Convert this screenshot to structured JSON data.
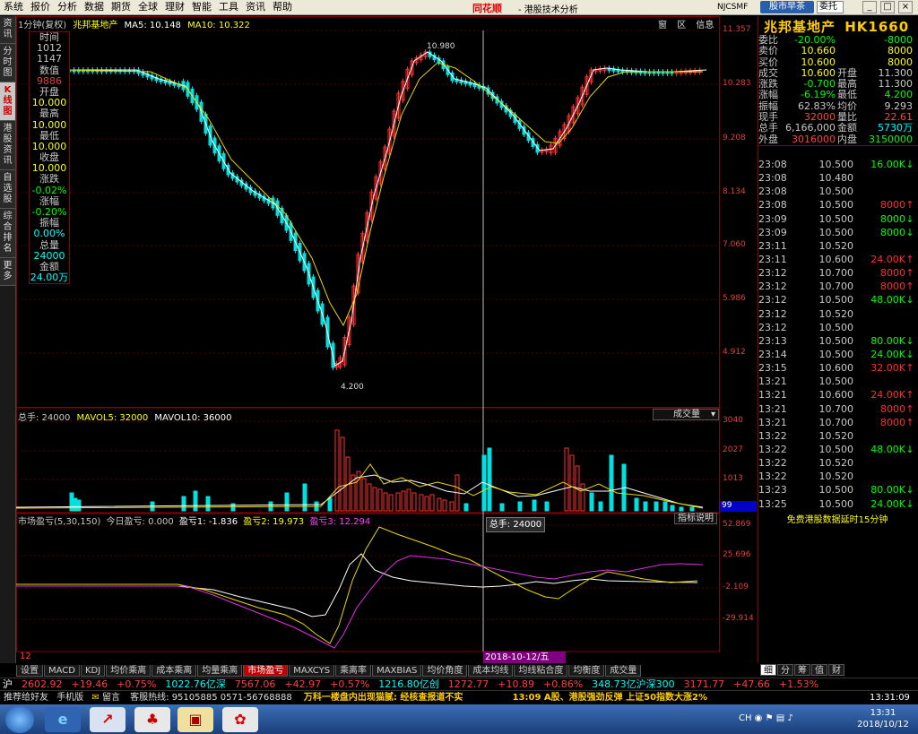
{
  "menu": [
    "系统",
    "报价",
    "分析",
    "数据",
    "期货",
    "全球",
    "理财",
    "智能",
    "工具",
    "资讯",
    "帮助"
  ],
  "brand": "同花顺",
  "brand_sub": "- 港股技术分析",
  "nj": "NJCSMF",
  "morning_btn": "股市早茶",
  "dele_btn": "委托",
  "win_btns": [
    "_",
    "□",
    "×"
  ],
  "left_tabs": [
    "资讯",
    "分时图",
    "K线图",
    "港股资讯",
    "自选股",
    "综合排名",
    "更多"
  ],
  "chart_header": {
    "period": "1分钟(复权)",
    "name": "兆邦基地产",
    "ma5": "MA5: 10.148",
    "ma10": "MA10: 10.322",
    "buttons": [
      "窗",
      "区",
      "信息"
    ]
  },
  "price_axis": [
    "11.357",
    "10.283",
    "9.208",
    "8.134",
    "7.060",
    "5.986",
    "4.912"
  ],
  "hi_label": "10.980",
  "lo_label": "4.200",
  "info_box": [
    {
      "t": "时间",
      "c": "#c8c8c8"
    },
    {
      "t": "1012",
      "c": "#c8c8c8"
    },
    {
      "t": "1147",
      "c": "#c8c8c8"
    },
    {
      "t": "数值",
      "c": "#c8c8c8"
    },
    {
      "t": "9886",
      "c": "#e04040"
    },
    {
      "t": "开盘",
      "c": "#c8c8c8"
    },
    {
      "t": "10.000",
      "c": "#ffff00"
    },
    {
      "t": "最高",
      "c": "#c8c8c8"
    },
    {
      "t": "10.000",
      "c": "#ffff00"
    },
    {
      "t": "最低",
      "c": "#c8c8c8"
    },
    {
      "t": "10.000",
      "c": "#ffff00"
    },
    {
      "t": "收盘",
      "c": "#c8c8c8"
    },
    {
      "t": "10.000",
      "c": "#ffff00"
    },
    {
      "t": "涨跌",
      "c": "#c8c8c8"
    },
    {
      "t": "-0.02%",
      "c": "#00ff00"
    },
    {
      "t": "涨幅",
      "c": "#c8c8c8"
    },
    {
      "t": "-0.20%",
      "c": "#00ff00"
    },
    {
      "t": "振幅",
      "c": "#c8c8c8"
    },
    {
      "t": "0.00%",
      "c": "#00ffff"
    },
    {
      "t": "总量",
      "c": "#c8c8c8"
    },
    {
      "t": "24000",
      "c": "#00ffff"
    },
    {
      "t": "金额",
      "c": "#c8c8c8"
    },
    {
      "t": "24.00万",
      "c": "#00ffff"
    }
  ],
  "vol_header": {
    "total": "总手: 24000",
    "mavol5": "MAVOL5: 32000",
    "mavol10": "MAVOL10: 36000",
    "dropdown": "成交量"
  },
  "vol_axis": [
    "3040",
    "2027",
    "1013"
  ],
  "vol_marker": "99",
  "ind_header": {
    "name": "市场盈亏(5,30,150)",
    "today": "今日盈亏: 0.000",
    "y1": "盈亏1: -1.836",
    "y2": "盈亏2: 19.973",
    "y3": "盈亏3: 12.294",
    "help": "指标说明"
  },
  "ind_axis": [
    "52.869",
    "25.696",
    "-2.109",
    "-29.914"
  ],
  "tooltip": "总手: 24000",
  "date_label": "2018-10-12/五",
  "left_num": "12",
  "bottom_tabs": [
    "设置",
    "MACD",
    "KDJ",
    "均价乘离",
    "成本乘离",
    "均量乘离",
    "市场盈亏",
    "MAXCYS",
    "乘离率",
    "MAXBIAS",
    "均价角度",
    "成本均线",
    "均线粘合度",
    "均衡度",
    "成交量"
  ],
  "active_bottom_tab": "市场盈亏",
  "stock": {
    "name": "兆邦基地产",
    "code": "HK1660"
  },
  "quote": [
    {
      "l": "委比",
      "v": "-20.00%",
      "vc": "#00ff00",
      "r": "",
      "rv": "-8000",
      "rc": "#00ff00"
    },
    {
      "l": "卖价",
      "v": "10.660",
      "vc": "#ffff00",
      "r": "",
      "rv": "8000",
      "rc": "#ffff00"
    },
    {
      "l": "买价",
      "v": "10.600",
      "vc": "#ffff00",
      "r": "",
      "rv": "8000",
      "rc": "#ffff00"
    },
    {
      "l": "成交",
      "v": "10.600",
      "vc": "#ffff00",
      "r": "开盘",
      "rv": "11.300",
      "rc": "#c8c8c8"
    },
    {
      "l": "涨跌",
      "v": "-0.700",
      "vc": "#00ff00",
      "r": "最高",
      "rv": "11.300",
      "rc": "#c8c8c8"
    },
    {
      "l": "涨幅",
      "v": "-6.19%",
      "vc": "#00ff00",
      "r": "最低",
      "rv": "4.200",
      "rc": "#00ff00"
    },
    {
      "l": "振幅",
      "v": "62.83%",
      "vc": "#c8c8c8",
      "r": "均价",
      "rv": "9.293",
      "rc": "#c8c8c8"
    },
    {
      "l": "现手",
      "v": "32000",
      "vc": "#ff4040",
      "r": "量比",
      "rv": "22.61",
      "rc": "#ff4040"
    },
    {
      "l": "总手",
      "v": "6,166,000",
      "vc": "#c8c8c8",
      "r": "金额",
      "rv": "5730万",
      "rc": "#00ffff"
    },
    {
      "l": "外盘",
      "v": "3016000",
      "vc": "#ff4040",
      "r": "内盘",
      "rv": "3150000",
      "rc": "#00ff00"
    }
  ],
  "trades": [
    {
      "t": "23:08",
      "p": "10.500",
      "v": "16.00K",
      "c": "#00ff00",
      "a": "↓"
    },
    {
      "t": "23:08",
      "p": "10.480",
      "v": "",
      "c": "#c8c8c8",
      "a": ""
    },
    {
      "t": "23:08",
      "p": "10.500",
      "v": "",
      "c": "#c8c8c8",
      "a": ""
    },
    {
      "t": "23:08",
      "p": "10.500",
      "v": "8000",
      "c": "#ff3030",
      "a": "↑"
    },
    {
      "t": "23:09",
      "p": "10.500",
      "v": "8000",
      "c": "#00ff00",
      "a": "↓"
    },
    {
      "t": "23:09",
      "p": "10.500",
      "v": "8000",
      "c": "#00ff00",
      "a": "↓"
    },
    {
      "t": "23:11",
      "p": "10.520",
      "v": "",
      "c": "#c8c8c8",
      "a": ""
    },
    {
      "t": "23:11",
      "p": "10.600",
      "v": "24.00K",
      "c": "#ff3030",
      "a": "↑"
    },
    {
      "t": "23:12",
      "p": "10.700",
      "v": "8000",
      "c": "#ff3030",
      "a": "↑"
    },
    {
      "t": "23:12",
      "p": "10.700",
      "v": "8000",
      "c": "#ff3030",
      "a": "↑"
    },
    {
      "t": "23:12",
      "p": "10.500",
      "v": "48.00K",
      "c": "#00ff00",
      "a": "↓"
    },
    {
      "t": "23:12",
      "p": "10.520",
      "v": "",
      "c": "#c8c8c8",
      "a": ""
    },
    {
      "t": "23:12",
      "p": "10.500",
      "v": "",
      "c": "#c8c8c8",
      "a": ""
    },
    {
      "t": "23:13",
      "p": "10.500",
      "v": "80.00K",
      "c": "#00ff00",
      "a": "↓"
    },
    {
      "t": "23:14",
      "p": "10.500",
      "v": "24.00K",
      "c": "#00ff00",
      "a": "↓"
    },
    {
      "t": "23:15",
      "p": "10.600",
      "v": "32.00K",
      "c": "#ff3030",
      "a": "↑"
    },
    {
      "t": "13:21",
      "p": "10.500",
      "v": "",
      "c": "#c8c8c8",
      "a": ""
    },
    {
      "t": "13:21",
      "p": "10.600",
      "v": "24.00K",
      "c": "#ff3030",
      "a": "↑"
    },
    {
      "t": "13:21",
      "p": "10.700",
      "v": "8000",
      "c": "#ff3030",
      "a": "↑"
    },
    {
      "t": "13:21",
      "p": "10.700",
      "v": "8000",
      "c": "#ff3030",
      "a": "↑"
    },
    {
      "t": "13:22",
      "p": "10.520",
      "v": "",
      "c": "#c8c8c8",
      "a": ""
    },
    {
      "t": "13:22",
      "p": "10.500",
      "v": "48.00K",
      "c": "#00ff00",
      "a": "↓"
    },
    {
      "t": "13:22",
      "p": "10.520",
      "v": "",
      "c": "#c8c8c8",
      "a": ""
    },
    {
      "t": "13:22",
      "p": "10.520",
      "v": "",
      "c": "#c8c8c8",
      "a": ""
    },
    {
      "t": "13:23",
      "p": "10.500",
      "v": "80.00K",
      "c": "#00ff00",
      "a": "↓"
    },
    {
      "t": "13:25",
      "p": "10.500",
      "v": "24.00K",
      "c": "#00ff00",
      "a": "↓"
    }
  ],
  "delay_note": "免费港股数据延时15分钟",
  "right_tabs": [
    "细",
    "分",
    "筹",
    "值",
    "财"
  ],
  "ticker": [
    {
      "t": "沪",
      "c": "#ffffff"
    },
    {
      "t": "2602.92",
      "c": "#ff4040"
    },
    {
      "t": "+19.46",
      "c": "#ff4040"
    },
    {
      "t": "+0.75%",
      "c": "#ff4040"
    },
    {
      "t": "1022.76亿深",
      "c": "#00ffff"
    },
    {
      "t": "7567.06",
      "c": "#ff4040"
    },
    {
      "t": "+42.97",
      "c": "#ff4040"
    },
    {
      "t": "+0.57%",
      "c": "#ff4040"
    },
    {
      "t": "1216.80亿创",
      "c": "#00ffff"
    },
    {
      "t": "1272.77",
      "c": "#ff4040"
    },
    {
      "t": "+10.89",
      "c": "#ff4040"
    },
    {
      "t": "+0.86%",
      "c": "#ff4040"
    },
    {
      "t": "348.73亿沪深300",
      "c": "#00ffff"
    },
    {
      "t": "3171.77",
      "c": "#ff4040"
    },
    {
      "t": "+47.66",
      "c": "#ff4040"
    },
    {
      "t": "+1.53%",
      "c": "#ff4040"
    }
  ],
  "status": {
    "recommend": "推荐给好友",
    "mobile": "手机版",
    "msg": "留言",
    "hotline": "客服热线: 95105885  0571-56768888",
    "news1": "万科一楼盘内出现猫腻: 经核查报道不实",
    "news2": "13:09 A股、港股强劲反弹 上证50指数大涨2%",
    "time": "13:31:09"
  },
  "clock": {
    "time": "13:31",
    "date": "2018/10/12"
  },
  "chart_data": {
    "type": "candlestick",
    "price_axis_ticks": [
      11.357,
      10.283,
      9.208,
      8.134,
      7.06,
      5.986,
      4.912
    ],
    "high_label": 10.98,
    "low_label": 4.2,
    "volume_axis_ticks": [
      3040,
      2027,
      1013
    ],
    "indicator_axis_ticks": [
      52.869,
      25.696,
      -2.109,
      -29.914
    ]
  }
}
